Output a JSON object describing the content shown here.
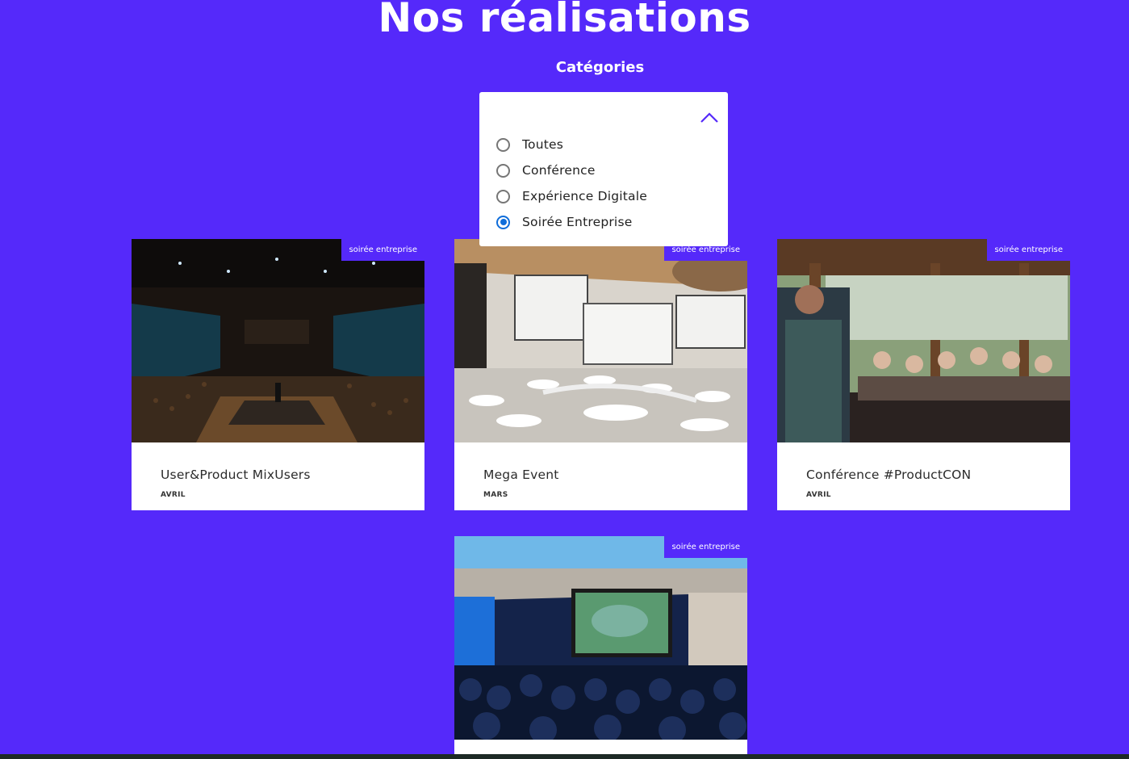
{
  "header": {
    "title": "Nos réalisations",
    "categories_label": "Catégories"
  },
  "filter": {
    "toggle_icon": "chevron-up-icon",
    "options": [
      {
        "label": "Toutes",
        "checked": false
      },
      {
        "label": "Conférence",
        "checked": false
      },
      {
        "label": "Expérience Digitale",
        "checked": false
      },
      {
        "label": "Soirée Entreprise",
        "checked": true
      }
    ],
    "radio_checked_color": "#0f6dda"
  },
  "cards": [
    {
      "badge": "soirée entreprise",
      "title": "User&Product MixUsers",
      "date": "AVRIL",
      "image": "conference-stage-photo"
    },
    {
      "badge": "soirée entreprise",
      "title": "Mega Event",
      "date": "MARS",
      "image": "empty-hall-photo"
    },
    {
      "badge": "soirée entreprise",
      "title": "Conférence #ProductCON",
      "date": "AVRIL",
      "image": "dinner-speaker-photo"
    },
    {
      "badge": "soirée entreprise",
      "title": "",
      "date": "",
      "image": "screening-audience-photo"
    }
  ],
  "colors": {
    "background": "#5529fa",
    "badge": "#5529fa",
    "card": "#ffffff"
  }
}
